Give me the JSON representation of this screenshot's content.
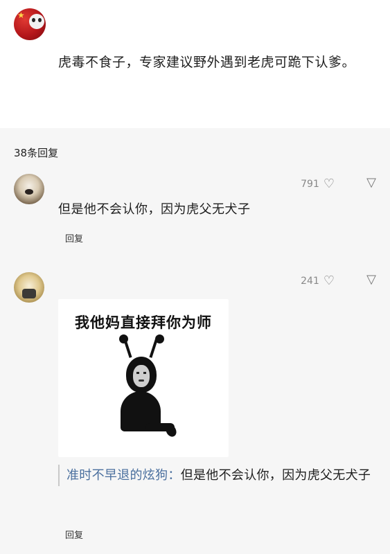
{
  "post": {
    "text": "虎毒不食子，专家建议野外遇到老虎可跪下认爹。"
  },
  "replies": {
    "count_label": "38条回复",
    "items": [
      {
        "likes": "791",
        "text": "但是他不会认你，因为虎父无犬子",
        "reply_label": "回复"
      },
      {
        "likes": "241",
        "meme_caption": "我他妈直接拜你为师",
        "quote_name": "准时不早退的炫狗：",
        "quote_text": "但是他不会认你，因为虎父无犬子",
        "reply_label": "回复"
      }
    ]
  },
  "icons": {
    "thumb_up": "👍",
    "thumb_down": "👎"
  }
}
